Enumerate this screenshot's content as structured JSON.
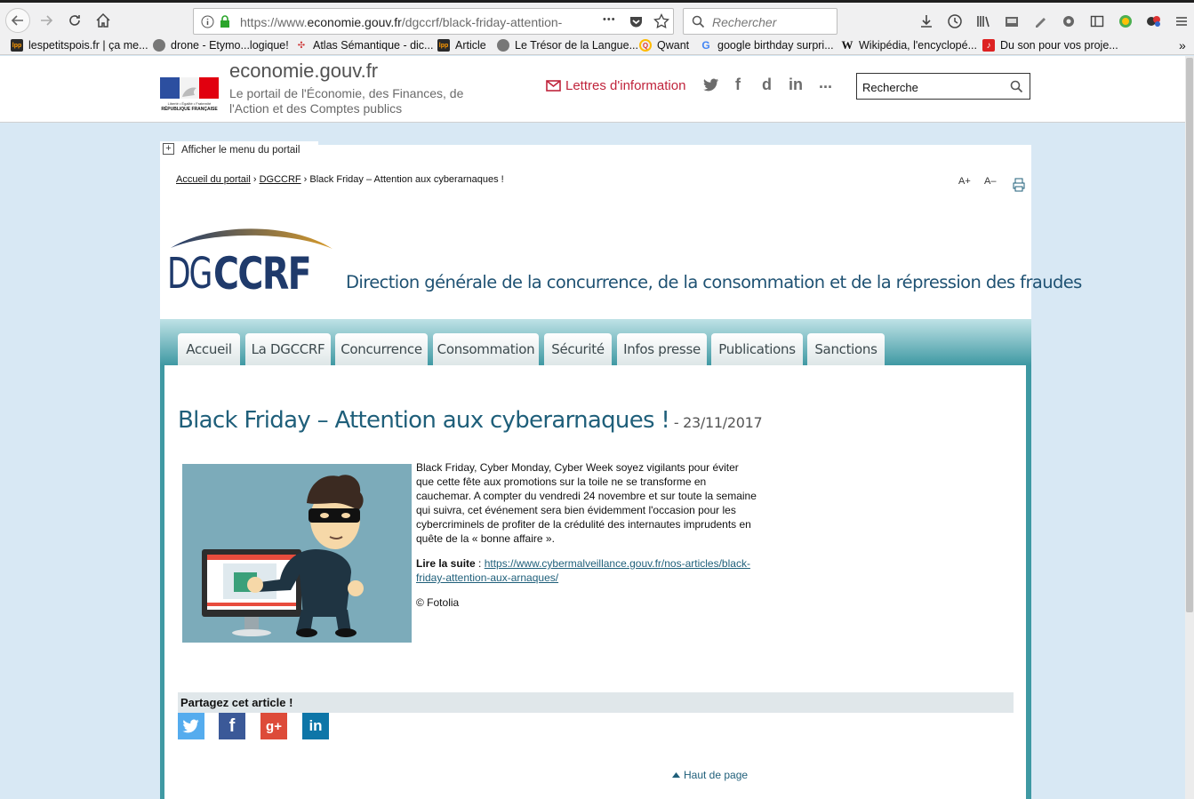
{
  "browser": {
    "url_prefix": "https://www.",
    "url_domain": "economie.gouv.fr",
    "url_path": "/dgccrf/black-friday-attention-",
    "search_placeholder": "Rechercher",
    "more_glyph": "•••"
  },
  "bookmarks": [
    "lespetitspois.fr | ça me...",
    "drone - Etymo...logique!",
    "Atlas Sémantique - dic...",
    "Article",
    "Le Trésor de la Langue...",
    "Qwant",
    "google birthday surpri...",
    "Wikipédia, l'encyclopé...",
    "Du son pour vos proje..."
  ],
  "bookmark_fav_letters": [
    "lpp",
    "",
    "",
    "lpp",
    "",
    "Q",
    "G",
    "W",
    ""
  ],
  "portal": {
    "site_name": "economie.gouv.fr",
    "tagline": "Le portail de l'Économie, des Finances, de l'Action et des Comptes publics",
    "newsletter_label": "Lettres d'information",
    "social": [
      "",
      "f",
      "d",
      "in",
      "..."
    ],
    "search_value": "Recherche",
    "marianne_text": "Liberté • Égalité • Fraternité",
    "republique": "RÉPUBLIQUE FRANÇAISE"
  },
  "page": {
    "show_menu_label": "Afficher le menu du portail",
    "breadcrumb": {
      "home": "Accueil du portail",
      "section": "DGCCRF",
      "current": "Black Friday – Attention aux cyberarnaques !"
    },
    "font_increase": "A+",
    "font_decrease": "A–",
    "logo_dg": "DG",
    "logo_ccrf": "CCRF",
    "dg_title": "Direction générale de la concurrence, de la consommation et de la répression des fraudes",
    "nav": [
      "Accueil",
      "La DGCCRF",
      "Concurrence",
      "Consommation",
      "Sécurité",
      "Infos presse",
      "Publications",
      "Sanctions"
    ],
    "article": {
      "title": "Black Friday – Attention aux cyberarnaques !",
      "date": " - 23/11/2017",
      "paragraph": "Black Friday, Cyber Monday, Cyber Week soyez vigilants pour éviter que cette fête aux promotions sur la toile ne se transforme en cauchemar. A compter du vendredi 24 novembre et sur toute la semaine qui suivra, cet événement sera bien évidemment l'occasion pour les cybercriminels de profiter de la crédulité des internautes imprudents en quête de la « bonne affaire ».",
      "read_more_label": "Lire la suite",
      "read_more_sep": " : ",
      "read_more_url": "https://www.cybermalveillance.gouv.fr/nos-articles/black-friday-attention-aux-arnaques/",
      "credit": "© Fotolia"
    },
    "share_title": "Partagez cet article !",
    "share_buttons": [
      "",
      "f",
      "g+",
      "in"
    ],
    "back_to_top": "Haut de page"
  },
  "colors": {
    "accent_teal": "#3f99a3",
    "title_blue": "#1f5f7a",
    "newsletter_red": "#c0243c",
    "twitter": "#55acee",
    "facebook": "#3b5998",
    "google_plus": "#dd4b39",
    "linkedin": "#0e76a8"
  }
}
